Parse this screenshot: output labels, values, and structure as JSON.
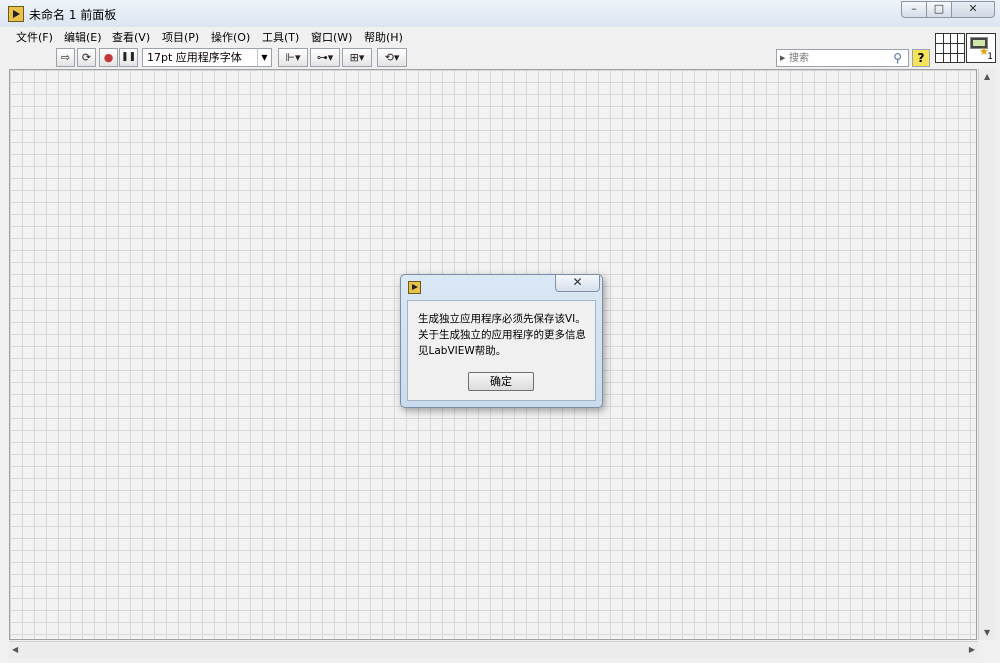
{
  "window": {
    "title": "未命名 1 前面板"
  },
  "titlebar_buttons": {
    "minimize": "–",
    "maximize": "□",
    "close": "✕"
  },
  "menu": [
    "文件(F)",
    "编辑(E)",
    "查看(V)",
    "项目(P)",
    "操作(O)",
    "工具(T)",
    "窗口(W)",
    "帮助(H)"
  ],
  "toolbar": {
    "run_icon": "⇨",
    "run_continuous_icon": "⟳",
    "abort_icon": "●",
    "pause_icon": "❚❚",
    "font": "17pt 应用程序字体",
    "align": "⊩▾",
    "distribute": "⊶▾",
    "resize": "⊞▾",
    "reorder": "⟲▾",
    "search_placeholder": "搜索",
    "help": "?"
  },
  "vi_icon": {
    "number": "1"
  },
  "dialog": {
    "message": "生成独立应用程序必须先保存该VI。关于生成独立的应用程序的更多信息见LabVIEW帮助。",
    "ok_label": "确定",
    "close_glyph": "✕"
  },
  "colors": {
    "canvas": "#f2f2f2",
    "grid": "#d8d8d8",
    "dialog_frame": "#c9dbee"
  }
}
